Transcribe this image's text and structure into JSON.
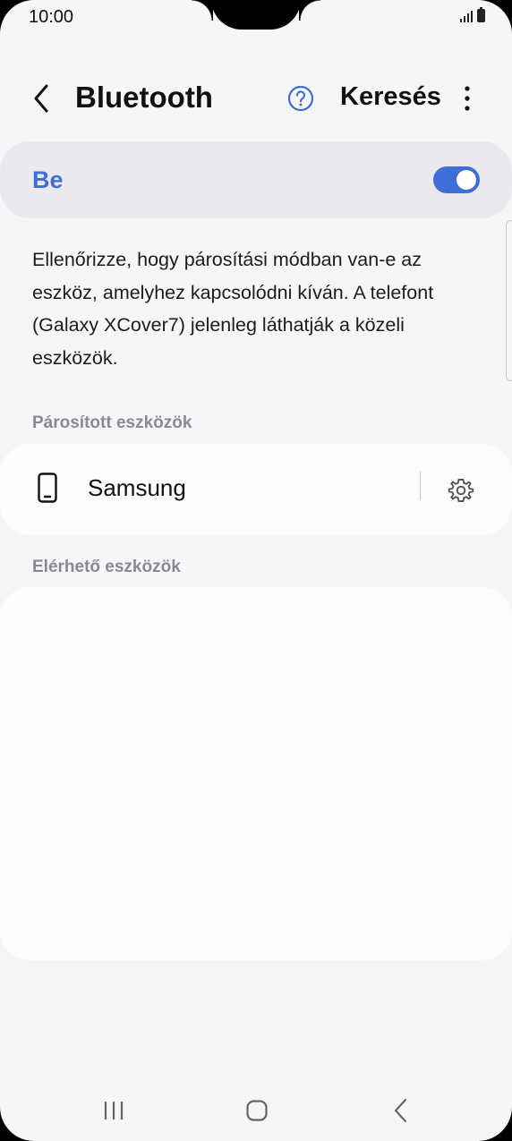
{
  "status_bar": {
    "time": "10:00"
  },
  "header": {
    "title": "Bluetooth",
    "search_label": "Keresés"
  },
  "toggle": {
    "label": "Be",
    "state": "on",
    "accent_color": "#3e6fd6"
  },
  "description": "Ellenőrizze, hogy párosítási módban van-e az eszköz, amelyhez kapcsolódni kíván. A telefont (Galaxy XCover7) jelenleg láthatják a közeli eszközök.",
  "paired": {
    "label": "Párosított eszközök",
    "devices": [
      {
        "name": "Samsung",
        "icon": "phone-icon"
      }
    ]
  },
  "available": {
    "label": "Elérhető eszközök",
    "devices": []
  },
  "icons": {
    "back": "back-arrow-icon",
    "help": "help-icon",
    "more": "more-options-icon",
    "settings": "gear-icon",
    "nav_recents": "recents-icon",
    "nav_home": "home-icon",
    "nav_back": "back-icon"
  }
}
